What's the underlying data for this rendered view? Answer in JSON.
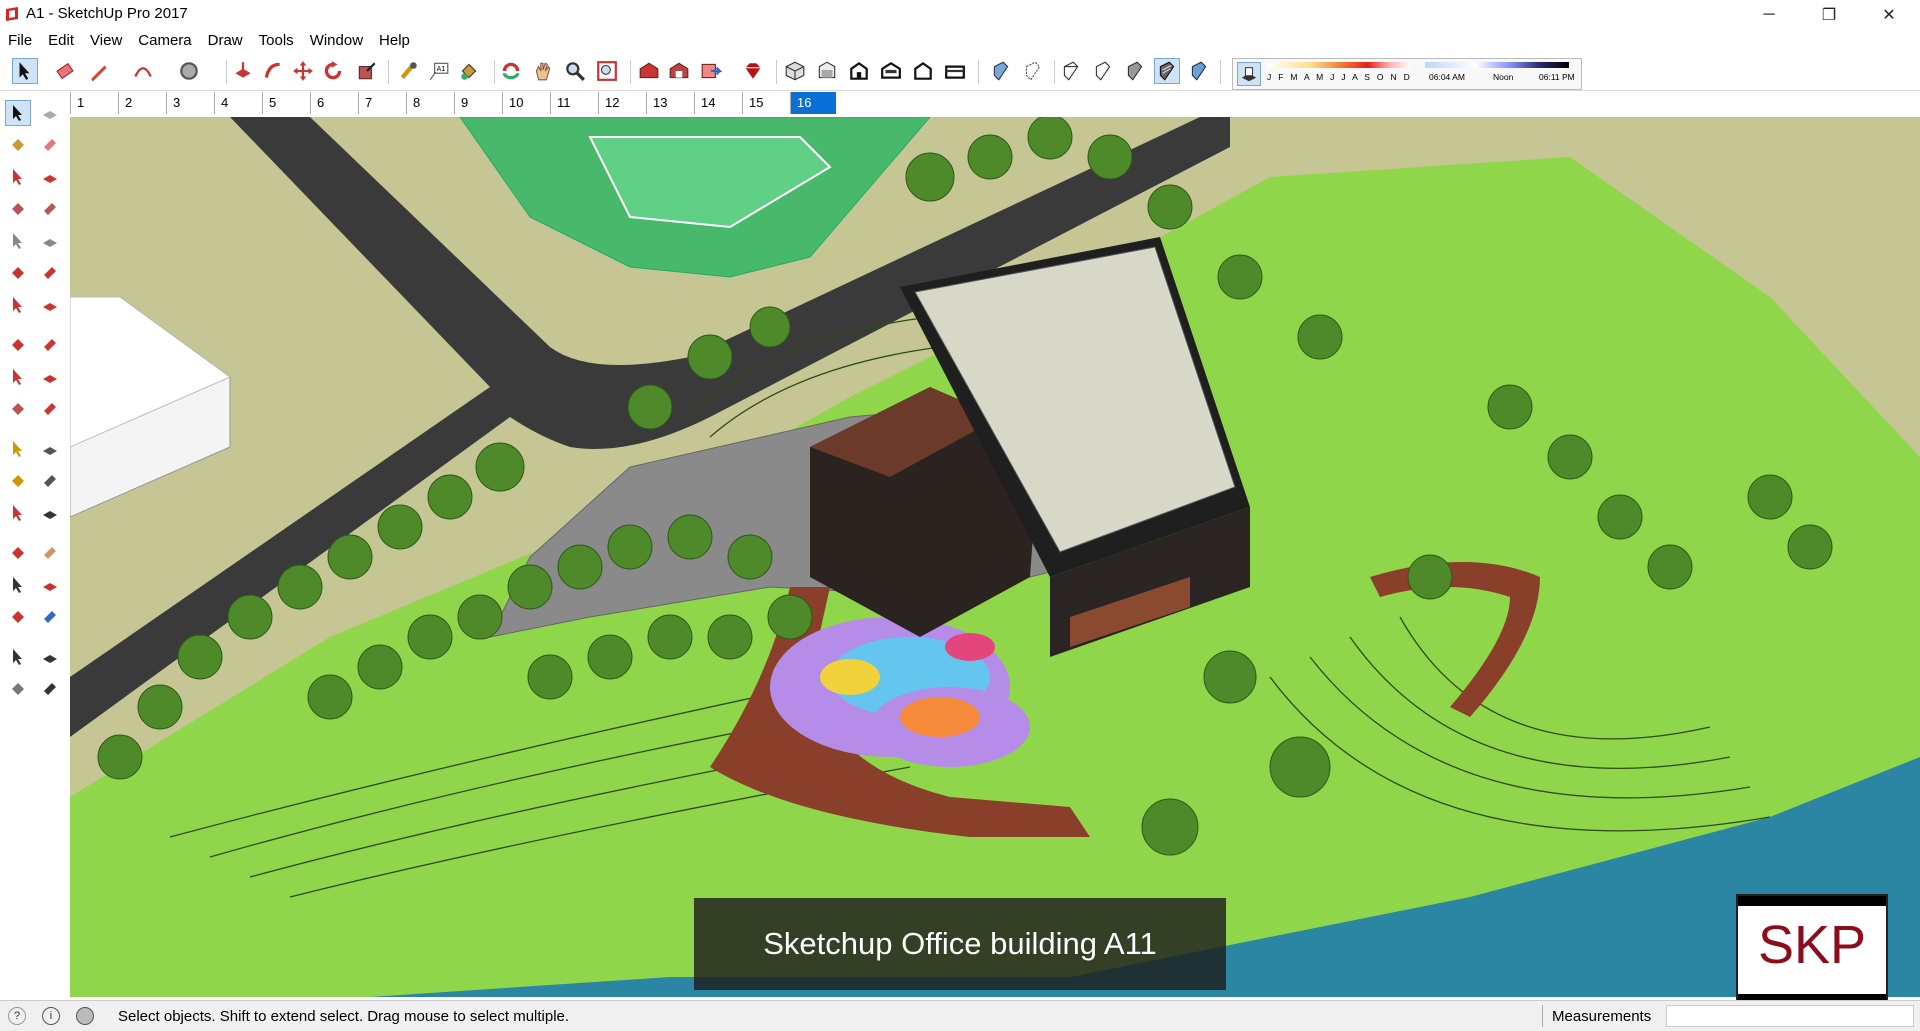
{
  "window": {
    "title": "A1 - SketchUp Pro 2017",
    "minimize_glyph": "─",
    "restore_glyph": "❐",
    "close_glyph": "✕"
  },
  "menu": [
    "File",
    "Edit",
    "View",
    "Camera",
    "Draw",
    "Tools",
    "Window",
    "Help"
  ],
  "toolbar": {
    "icons": [
      "select-icon",
      "eraser-icon",
      "pencil-icon",
      "arc-icon",
      "circle-icon",
      "push-pull-icon",
      "follow-me-icon",
      "move-icon",
      "rotate-icon",
      "scale-icon",
      "tape-measure-icon",
      "text-icon",
      "paint-bucket-icon",
      "orbit-icon",
      "pan-icon",
      "zoom-icon",
      "zoom-extents-icon",
      "warehouse-icon",
      "extension-warehouse-icon",
      "send-to-layout-icon",
      "ruby-icon",
      "iso-view-icon",
      "top-view-icon",
      "front-view-icon",
      "right-view-icon",
      "back-view-icon",
      "left-view-icon",
      "xray-icon",
      "back-edges-icon",
      "wireframe-icon",
      "hidden-line-icon",
      "shaded-icon",
      "shaded-textures-icon",
      "monochrome-icon",
      "shadows-toggle-icon"
    ]
  },
  "shadows": {
    "months": "J F M A M J J A S O N D",
    "time_start": "06:04 AM",
    "time_mid": "Noon",
    "time_end": "06:11 PM"
  },
  "scenes": [
    "1",
    "2",
    "3",
    "4",
    "5",
    "6",
    "7",
    "8",
    "9",
    "10",
    "11",
    "12",
    "13",
    "14",
    "15",
    "16"
  ],
  "active_scene": "16",
  "left_tools": [
    "select-icon",
    "component-icon",
    "paint-bucket-icon",
    "eraser-icon",
    "line-icon",
    "freehand-icon",
    "rectangle-icon",
    "rotated-rectangle-icon",
    "circle-icon",
    "polygon-icon",
    "arc-icon",
    "two-point-arc-icon",
    "pie-icon",
    "three-point-arc-icon",
    "move-icon",
    "push-pull-icon",
    "rotate-icon",
    "follow-me-icon",
    "scale-icon",
    "offset-icon",
    "tape-measure-icon",
    "dimension-icon",
    "protractor-icon",
    "text-icon",
    "axes-icon",
    "3d-text-icon",
    "orbit-icon",
    "pan-icon",
    "zoom-icon",
    "zoom-window-icon",
    "zoom-extents-icon",
    "previous-view-icon",
    "position-camera-icon",
    "look-around-icon",
    "walk-icon",
    "section-plane-icon"
  ],
  "caption": "Sketchup Office building A11",
  "logo": "SKP",
  "status": {
    "message": "Select objects. Shift to extend select. Drag mouse to select multiple.",
    "measurements_label": "Measurements",
    "measurements_value": ""
  },
  "colors": {
    "ground": "#c6c694",
    "grass": "#8fd64a",
    "water": "#2b86a3",
    "road": "#3a3a3a",
    "plaza": "#8a8a8a",
    "accent": "#0a6fd6"
  }
}
